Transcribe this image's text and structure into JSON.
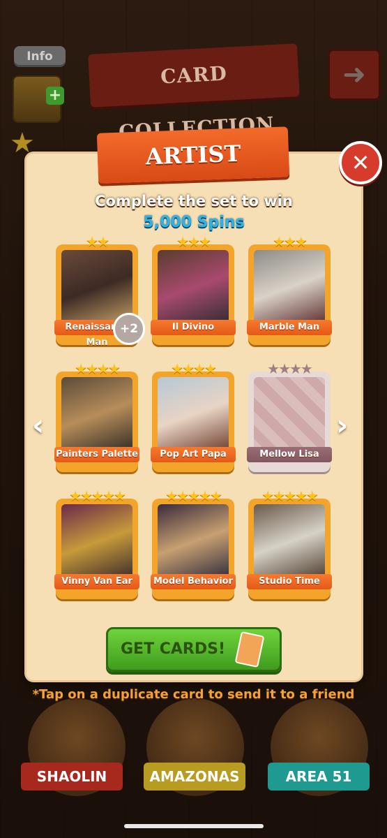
{
  "topbar": {
    "info": "Info",
    "title": "CARD COLLECTION",
    "back_icon": "back-arrow-icon"
  },
  "modal": {
    "set_name": "ARTIST",
    "subtitle": "Complete the set to win",
    "reward": "5,000 Spins",
    "cards": [
      {
        "name": "Renaissance Man",
        "stars": 2,
        "owned": true,
        "duplicate_badge": "+2"
      },
      {
        "name": "Il Divino",
        "stars": 3,
        "owned": true
      },
      {
        "name": "Marble Man",
        "stars": 3,
        "owned": true
      },
      {
        "name": "Painters Palette",
        "stars": 4,
        "owned": true
      },
      {
        "name": "Pop Art Papa",
        "stars": 4,
        "owned": true
      },
      {
        "name": "Mellow Lisa",
        "stars": 4,
        "owned": false
      },
      {
        "name": "Vinny Van Ear",
        "stars": 5,
        "owned": true
      },
      {
        "name": "Model Behavior",
        "stars": 5,
        "owned": true
      },
      {
        "name": "Studio Time",
        "stars": 5,
        "owned": true
      }
    ],
    "get_cards": "GET CARDS!"
  },
  "hint": "*Tap on a duplicate card to send it to a friend",
  "sets": [
    {
      "name": "SHAOLIN",
      "color": "#c23528"
    },
    {
      "name": "AMAZONAS",
      "color": "#c6b02b"
    },
    {
      "name": "AREA 51",
      "color": "#2fb0a6"
    }
  ],
  "colors": {
    "orange": "#f3a52b",
    "green": "#4fb628",
    "spins": "#2fb2e6"
  }
}
